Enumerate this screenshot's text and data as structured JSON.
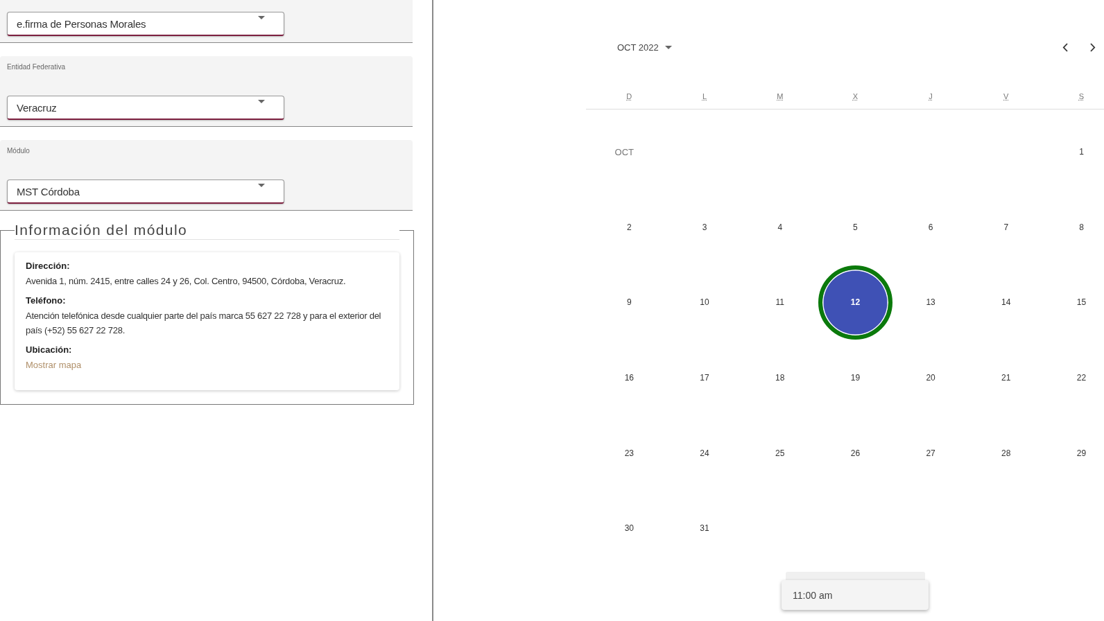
{
  "form": {
    "fields": [
      {
        "kind": "select",
        "value": "e.firma de Personas Morales"
      },
      {
        "kind": "select",
        "label": "Entidad Federativa",
        "value": "Veracruz"
      },
      {
        "kind": "select",
        "label": "Módulo",
        "value": "MST Córdoba"
      }
    ]
  },
  "module_info": {
    "title": "Información del módulo",
    "entries": [
      {
        "label": "Dirección:",
        "kind": "text",
        "value": "Avenida 1, núm. 2415, entre calles 24 y 26, Col. Centro, 94500, Córdoba, Veracruz."
      },
      {
        "label": "Teléfono:",
        "kind": "text",
        "value": "Atención telefónica desde cualquier parte del país marca 55 627 22 728 y para el exterior del país (+52) 55 627 22 728."
      },
      {
        "label": "Ubicación:",
        "kind": "link",
        "value": "Mostrar mapa"
      }
    ]
  },
  "calendar": {
    "month_label": "OCT 2022",
    "weekdays": [
      "D",
      "L",
      "M",
      "X",
      "J",
      "V",
      "S"
    ],
    "weeks": [
      [
        {
          "kind": "month",
          "label": "OCT"
        },
        {
          "kind": "blank"
        },
        {
          "kind": "blank"
        },
        {
          "kind": "blank"
        },
        {
          "kind": "blank"
        },
        {
          "kind": "blank"
        },
        {
          "kind": "day",
          "label": "1",
          "selected": false
        }
      ],
      [
        {
          "kind": "day",
          "label": "2",
          "selected": false
        },
        {
          "kind": "day",
          "label": "3",
          "selected": false
        },
        {
          "kind": "day",
          "label": "4",
          "selected": false
        },
        {
          "kind": "day",
          "label": "5",
          "selected": false
        },
        {
          "kind": "day",
          "label": "6",
          "selected": false
        },
        {
          "kind": "day",
          "label": "7",
          "selected": false
        },
        {
          "kind": "day",
          "label": "8",
          "selected": false
        }
      ],
      [
        {
          "kind": "day",
          "label": "9",
          "selected": false
        },
        {
          "kind": "day",
          "label": "10",
          "selected": false
        },
        {
          "kind": "day",
          "label": "11",
          "selected": false
        },
        {
          "kind": "day",
          "label": "12",
          "selected": true
        },
        {
          "kind": "day",
          "label": "13",
          "selected": false
        },
        {
          "kind": "day",
          "label": "14",
          "selected": false
        },
        {
          "kind": "day",
          "label": "15",
          "selected": false
        }
      ],
      [
        {
          "kind": "day",
          "label": "16",
          "selected": false
        },
        {
          "kind": "day",
          "label": "17",
          "selected": false
        },
        {
          "kind": "day",
          "label": "18",
          "selected": false
        },
        {
          "kind": "day",
          "label": "19",
          "selected": false
        },
        {
          "kind": "day",
          "label": "20",
          "selected": false
        },
        {
          "kind": "day",
          "label": "21",
          "selected": false
        },
        {
          "kind": "day",
          "label": "22",
          "selected": false
        }
      ],
      [
        {
          "kind": "day",
          "label": "23",
          "selected": false
        },
        {
          "kind": "day",
          "label": "24",
          "selected": false
        },
        {
          "kind": "day",
          "label": "25",
          "selected": false
        },
        {
          "kind": "day",
          "label": "26",
          "selected": false
        },
        {
          "kind": "day",
          "label": "27",
          "selected": false
        },
        {
          "kind": "day",
          "label": "28",
          "selected": false
        },
        {
          "kind": "day",
          "label": "29",
          "selected": false
        }
      ],
      [
        {
          "kind": "day",
          "label": "30",
          "selected": false
        },
        {
          "kind": "day",
          "label": "31",
          "selected": false
        }
      ]
    ]
  },
  "time_menu": {
    "options": [
      {
        "label": "11:00 am"
      }
    ]
  }
}
